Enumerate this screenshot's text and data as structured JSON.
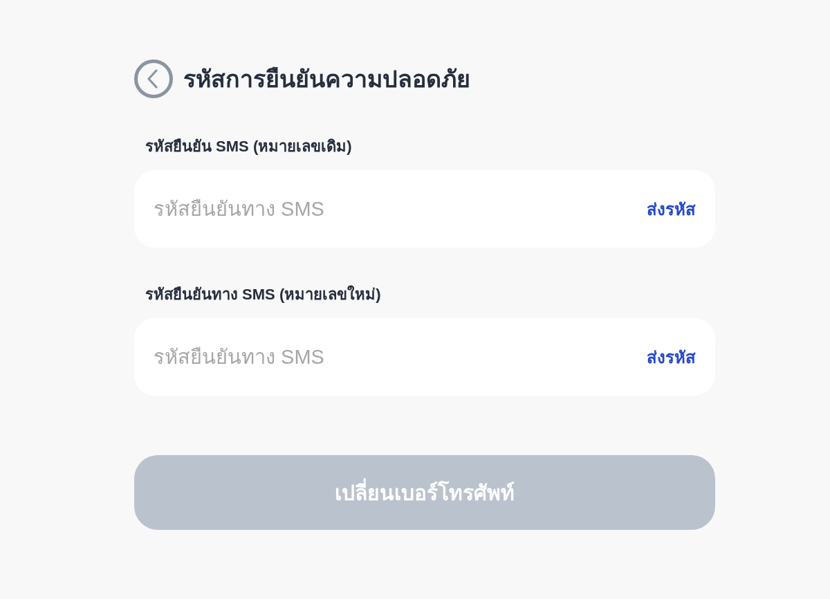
{
  "header": {
    "title": "รหัสการยืนยันความปลอดภัย"
  },
  "fields": [
    {
      "label": "รหัสยืนยัน SMS (หมายเลขเดิม)",
      "placeholder": "รหัสยืนยันทาง SMS",
      "action": "ส่งรหัส"
    },
    {
      "label": "รหัสยืนยันทาง SMS (หมายเลขใหม่)",
      "placeholder": "รหัสยืนยันทาง SMS",
      "action": "ส่งรหัส"
    }
  ],
  "submit_button": {
    "label": "เปลี่ยนเบอร์โทรศัพท์",
    "disabled": true
  }
}
